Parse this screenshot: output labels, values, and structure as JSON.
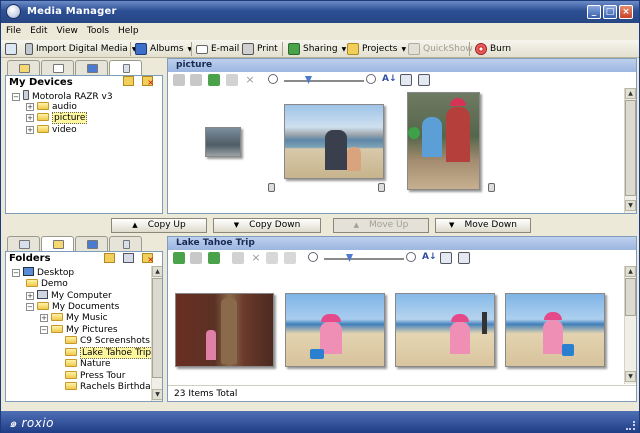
{
  "window": {
    "title": "Media Manager",
    "app_icon": "app-globe-icon"
  },
  "menu": [
    "File",
    "Edit",
    "View",
    "Tools",
    "Help"
  ],
  "toolbar": {
    "import": "Import Digital Media",
    "albums": "Albums",
    "email": "E-mail",
    "print": "Print",
    "sharing": "Sharing",
    "projects": "Projects",
    "quickshow": "QuickShow",
    "burn": "Burn"
  },
  "devices": {
    "header": "My Devices",
    "device": "Motorola RAZR v3",
    "folders": [
      "audio",
      "picture",
      "video"
    ],
    "selected": "picture"
  },
  "device_view": {
    "title": "picture"
  },
  "transfer": {
    "copy_up": "Copy Up",
    "copy_down": "Copy Down",
    "move_up": "Move Up",
    "move_down": "Move Down"
  },
  "folders": {
    "header": "Folders",
    "items": [
      "Desktop",
      "Demo",
      "My Computer",
      "My Documents",
      "My Music",
      "My Pictures",
      "C9 Screenshots",
      "Lake Tahoe Trip",
      "Nature",
      "Press Tour",
      "Rachels Birthday"
    ],
    "selected": "Lake Tahoe Trip"
  },
  "album_view": {
    "title": "Lake Tahoe Trip",
    "status": "23 Items Total"
  },
  "branding": {
    "logo": "roxio"
  },
  "colors": {
    "title_bar": "#2c4f95",
    "selection": "#fff7a0",
    "panel_header": "#9cb6e0"
  }
}
